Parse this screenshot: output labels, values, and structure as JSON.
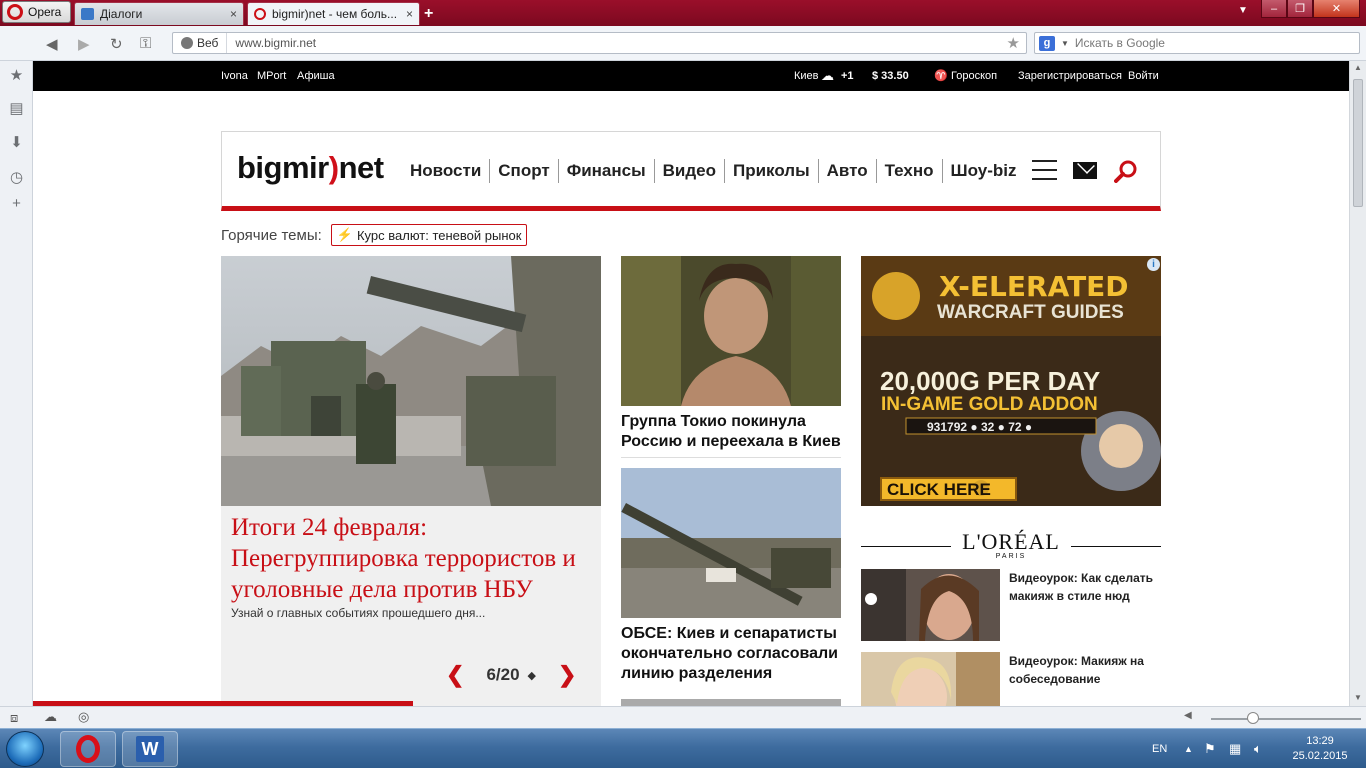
{
  "browser": {
    "opera_menu_label": "Opera",
    "tabs": [
      {
        "title": "Діалоги",
        "close": "×"
      },
      {
        "title": "bigmir)net - чем боль...",
        "close": "×"
      }
    ],
    "new_tab": "+",
    "url_scheme_label": "Веб",
    "url": "www.bigmir.net",
    "search_placeholder": "Искать в Google",
    "search_engine_badge": "g",
    "window_controls": {
      "minimize": "–",
      "maximize": "❐",
      "close": "✕"
    }
  },
  "taskbar": {
    "language": "EN",
    "time": "13:29",
    "date": "25.02.2015"
  },
  "site": {
    "topstrip": {
      "left_links": [
        "Ivona",
        "MPort",
        "Афиша"
      ],
      "weather_city": "Киев",
      "weather_temp": "+1",
      "currency": "$ 33.50",
      "horoscope": "Гороскоп",
      "register": "Зарегистрироваться",
      "login": "Войти"
    },
    "logo": {
      "before": "bigmir",
      "paren": ")",
      "after": "net"
    },
    "nav": [
      "Новости",
      "Спорт",
      "Финансы",
      "Видео",
      "Приколы",
      "Авто",
      "Техно",
      "Шоу-biz"
    ],
    "hot_topics": {
      "label": "Горячие темы:",
      "chip": "Курс валют: теневой рынок"
    },
    "main_story": {
      "title": "Итоги 24 февраля: Перегруппировка террористов и уголовные дела против НБУ",
      "lead": "Узнай о главных событиях прошедшего дня...",
      "pager": "6/20",
      "prev": "❮",
      "next": "❯"
    },
    "mid_stories": [
      {
        "title": "Группа Токио покинула Россию и переехала в Киев"
      },
      {
        "title": "ОБСЕ: Киев и сепаратисты окончательно согласовали линию разделения"
      }
    ],
    "ad": {
      "line1": "X-ELERATED",
      "line2": "WARCRAFT GUIDES",
      "line3": "20,000G PER DAY",
      "line4": "IN-GAME GOLD ADDON",
      "counter": "931792 ● 32 ● 72 ●",
      "cta": "CLICK HERE",
      "info": "i"
    },
    "sponsor": {
      "brand": "L'ORÉAL",
      "sub": "PARIS"
    },
    "side_items": [
      {
        "title": "Видеоурок: Как сделать макияж в стиле нюд"
      },
      {
        "title": "Видеоурок: Макияж на собеседование"
      }
    ]
  }
}
